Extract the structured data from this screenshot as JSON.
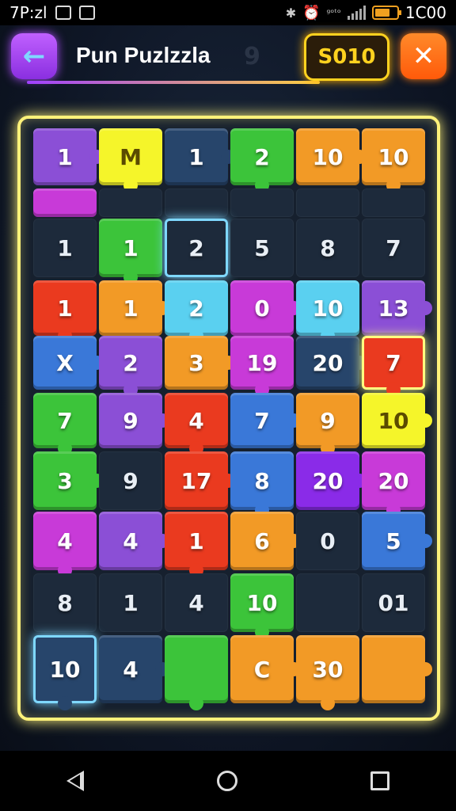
{
  "status_bar": {
    "time": "7P:zl",
    "battery": "1C00",
    "carrier": "ᵍᵒᵗᵒ"
  },
  "header": {
    "back_icon": "arrow-left-icon",
    "title": "Pun Puzlzzla",
    "title_ghost": "9",
    "score": "S010",
    "close_icon": "close-x-icon"
  },
  "colors": {
    "purple": "#8b4fd6",
    "yellow": "#f5f52a",
    "navy": "#27456b",
    "green": "#3cc43a",
    "orange": "#f29a26",
    "red": "#ea3a1f",
    "cyan": "#5ad0f0",
    "magenta": "#c83ad8",
    "blue": "#3a78d8",
    "dark": "#1d2a3b",
    "violet": "#8a2be8"
  },
  "board": {
    "rows": [
      [
        {
          "t": "1",
          "c": "purple"
        },
        {
          "t": "M",
          "c": "yellow"
        },
        {
          "t": "1",
          "c": "navy"
        },
        {
          "t": "2",
          "c": "green"
        },
        {
          "t": "10",
          "c": "orange"
        },
        {
          "t": "10",
          "c": "orange"
        }
      ],
      [
        {
          "t": "",
          "c": "magenta"
        },
        {
          "t": "",
          "c": "dark"
        },
        {
          "t": "",
          "c": "dark"
        },
        {
          "t": "",
          "c": "dark"
        },
        {
          "t": "",
          "c": "dark"
        },
        {
          "t": "",
          "c": "dark"
        }
      ],
      [
        {
          "t": "1",
          "c": "dark"
        },
        {
          "t": "1",
          "c": "green"
        },
        {
          "t": "2",
          "c": "dark"
        },
        {
          "t": "5",
          "c": "dark"
        },
        {
          "t": "8",
          "c": "dark"
        },
        {
          "t": "7",
          "c": "dark"
        }
      ],
      [
        {
          "t": "1",
          "c": "red"
        },
        {
          "t": "1",
          "c": "orange"
        },
        {
          "t": "2",
          "c": "cyan"
        },
        {
          "t": "0",
          "c": "magenta"
        },
        {
          "t": "10",
          "c": "cyan"
        },
        {
          "t": "13",
          "c": "purple"
        }
      ],
      [
        {
          "t": "X",
          "c": "blue"
        },
        {
          "t": "2",
          "c": "purple"
        },
        {
          "t": "3",
          "c": "orange"
        },
        {
          "t": "19",
          "c": "magenta"
        },
        {
          "t": "20",
          "c": "navy"
        },
        {
          "t": "7",
          "c": "red"
        }
      ],
      [
        {
          "t": "7",
          "c": "green"
        },
        {
          "t": "9",
          "c": "purple"
        },
        {
          "t": "4",
          "c": "red"
        },
        {
          "t": "7",
          "c": "blue"
        },
        {
          "t": "9",
          "c": "orange"
        },
        {
          "t": "10",
          "c": "yellow"
        }
      ],
      [
        {
          "t": "3",
          "c": "green"
        },
        {
          "t": "9",
          "c": "dark"
        },
        {
          "t": "17",
          "c": "red"
        },
        {
          "t": "8",
          "c": "blue"
        },
        {
          "t": "20",
          "c": "violet"
        },
        {
          "t": "20",
          "c": "magenta"
        }
      ],
      [
        {
          "t": "4",
          "c": "magenta"
        },
        {
          "t": "4",
          "c": "purple"
        },
        {
          "t": "1",
          "c": "red"
        },
        {
          "t": "6",
          "c": "orange"
        },
        {
          "t": "0",
          "c": "dark"
        },
        {
          "t": "5",
          "c": "blue"
        }
      ],
      [
        {
          "t": "8",
          "c": "dark"
        },
        {
          "t": "1",
          "c": "dark"
        },
        {
          "t": "4",
          "c": "dark"
        },
        {
          "t": "10",
          "c": "green"
        },
        {
          "t": "",
          "c": "dark"
        },
        {
          "t": "01",
          "c": "dark"
        }
      ],
      [
        {
          "t": "10",
          "c": "navy"
        },
        {
          "t": "4",
          "c": "navy"
        },
        {
          "t": "",
          "c": "green"
        },
        {
          "t": "C",
          "c": "orange"
        },
        {
          "t": "30",
          "c": "orange"
        },
        {
          "t": "",
          "c": "orange"
        }
      ]
    ]
  }
}
